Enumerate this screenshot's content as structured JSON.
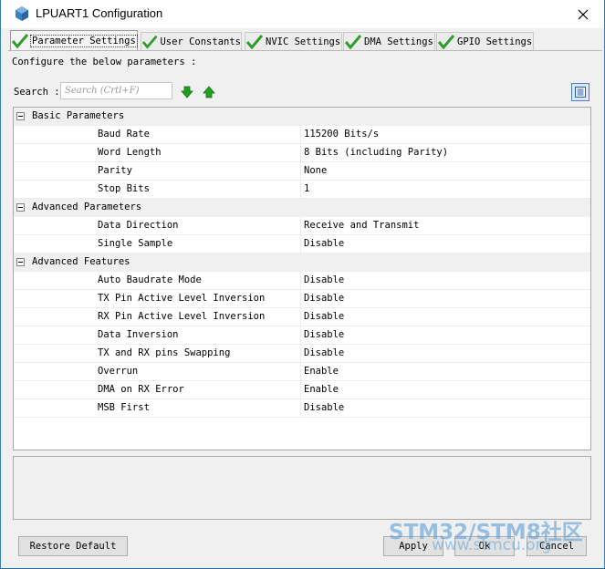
{
  "window": {
    "title": "LPUART1 Configuration",
    "close_glyph": "✕"
  },
  "tabs": [
    {
      "label": "Parameter Settings",
      "active": true,
      "icon": "green-checkmark-icon"
    },
    {
      "label": "User Constants",
      "active": false,
      "icon": "green-checkmark-icon"
    },
    {
      "label": "NVIC Settings",
      "active": false,
      "icon": "green-checkmark-icon"
    },
    {
      "label": "DMA Settings",
      "active": false,
      "icon": "green-checkmark-icon"
    },
    {
      "label": "GPIO Settings",
      "active": false,
      "icon": "green-checkmark-icon"
    }
  ],
  "configure_text": "Configure the below parameters :",
  "search": {
    "label": "Search :",
    "placeholder": "Search (Crtl+F)"
  },
  "sections": [
    {
      "label": "Basic Parameters",
      "params": [
        {
          "name": "Baud Rate",
          "value": "115200 Bits/s"
        },
        {
          "name": "Word Length",
          "value": "8 Bits (including Parity)"
        },
        {
          "name": "Parity",
          "value": "None"
        },
        {
          "name": "Stop Bits",
          "value": "1"
        }
      ]
    },
    {
      "label": "Advanced Parameters",
      "params": [
        {
          "name": "Data Direction",
          "value": "Receive and Transmit"
        },
        {
          "name": "Single Sample",
          "value": "Disable"
        }
      ]
    },
    {
      "label": "Advanced Features",
      "params": [
        {
          "name": "Auto Baudrate Mode",
          "value": "Disable"
        },
        {
          "name": "TX Pin Active Level Inversion",
          "value": "Disable"
        },
        {
          "name": "RX Pin Active Level Inversion",
          "value": "Disable"
        },
        {
          "name": "Data Inversion",
          "value": "Disable"
        },
        {
          "name": "TX and RX pins Swapping",
          "value": "Disable"
        },
        {
          "name": "Overrun",
          "value": "Enable"
        },
        {
          "name": "DMA on RX Error",
          "value": "Enable"
        },
        {
          "name": "MSB First",
          "value": "Disable"
        }
      ]
    }
  ],
  "buttons": {
    "restore": "Restore Default",
    "apply": "Apply",
    "ok": "Ok",
    "cancel": "Cancel"
  },
  "watermark": {
    "text": "STM32/STM8社区",
    "url": "www.stmcu.org"
  },
  "colors": {
    "check_green": "#2e9e2a",
    "arrow_green": "#1fa01f",
    "desktop_blue": "#1a6fb5"
  }
}
